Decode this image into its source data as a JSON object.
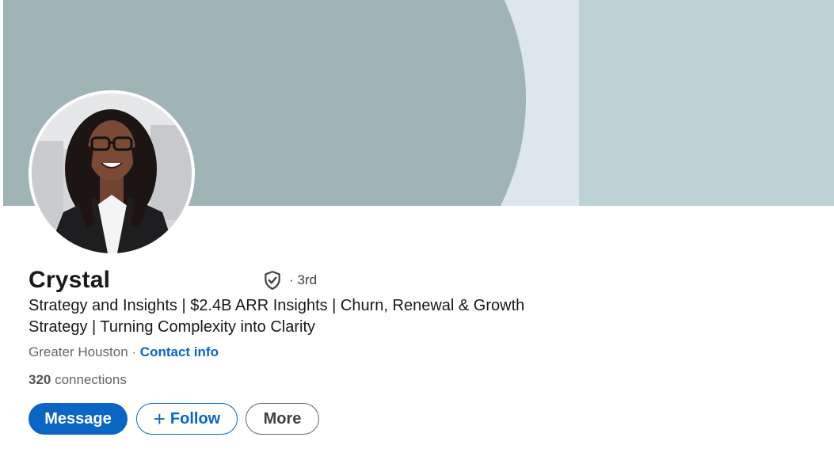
{
  "profile": {
    "name": "Crystal",
    "degree": "· 3rd",
    "verified_icon": "shield-check-icon",
    "headline_line1": "Strategy and Insights | $2.4B ARR Insights | Churn, Renewal & Growth",
    "headline_line2": "Strategy | Turning Complexity into Clarity",
    "location": "Greater Houston",
    "location_separator": " · ",
    "contact_info": "Contact info",
    "connections_count": "320",
    "connections_label": " connections"
  },
  "actions": {
    "message": "Message",
    "follow_plus": "+",
    "follow": "Follow",
    "more": "More"
  },
  "colors": {
    "accent": "#0a66c2",
    "cover_left": "#a0b3b7",
    "cover_right": "#bdd1d6",
    "cover_mid": "#dce6ec"
  }
}
